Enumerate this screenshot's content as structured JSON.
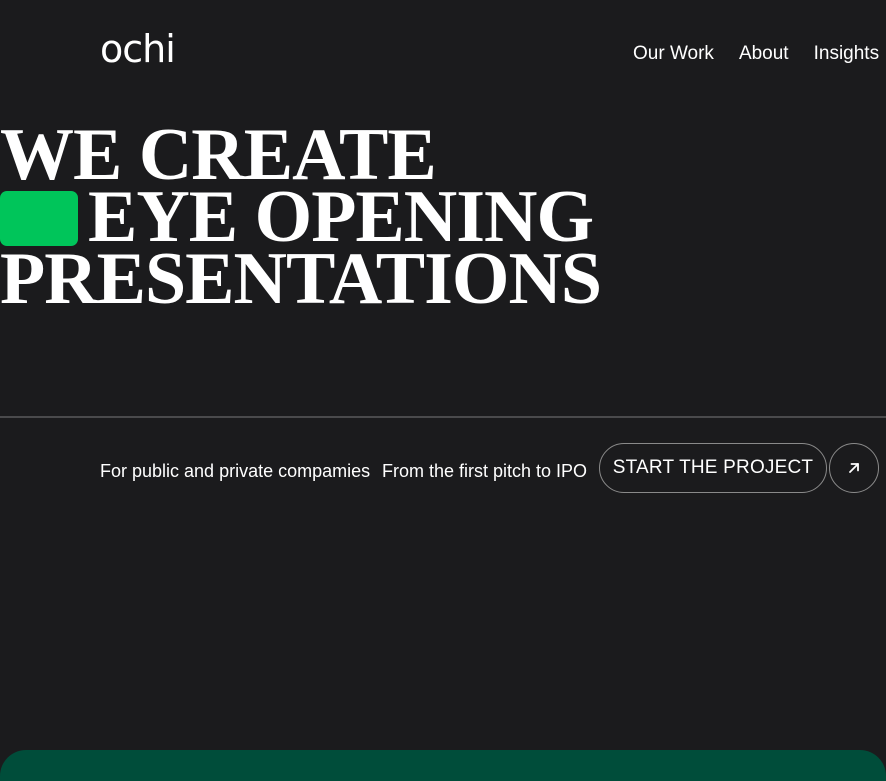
{
  "header": {
    "logo_text": "ochi",
    "nav": [
      {
        "label": "Our Work"
      },
      {
        "label": "About"
      },
      {
        "label": "Insights"
      }
    ]
  },
  "hero": {
    "line1": "WE CREATE",
    "line2": "EYE OPENING",
    "line3": "PRESENTATIONS"
  },
  "info": {
    "tag1": "For public and private compamies",
    "tag2": "From the first pitch to IPO",
    "cta_label": "START THE PROJECT",
    "cta_icon": "arrow-up-right-icon"
  },
  "colors": {
    "background": "#1b1b1d",
    "accent": "#00c55a",
    "panel": "#004d3a",
    "text": "#ffffff"
  }
}
